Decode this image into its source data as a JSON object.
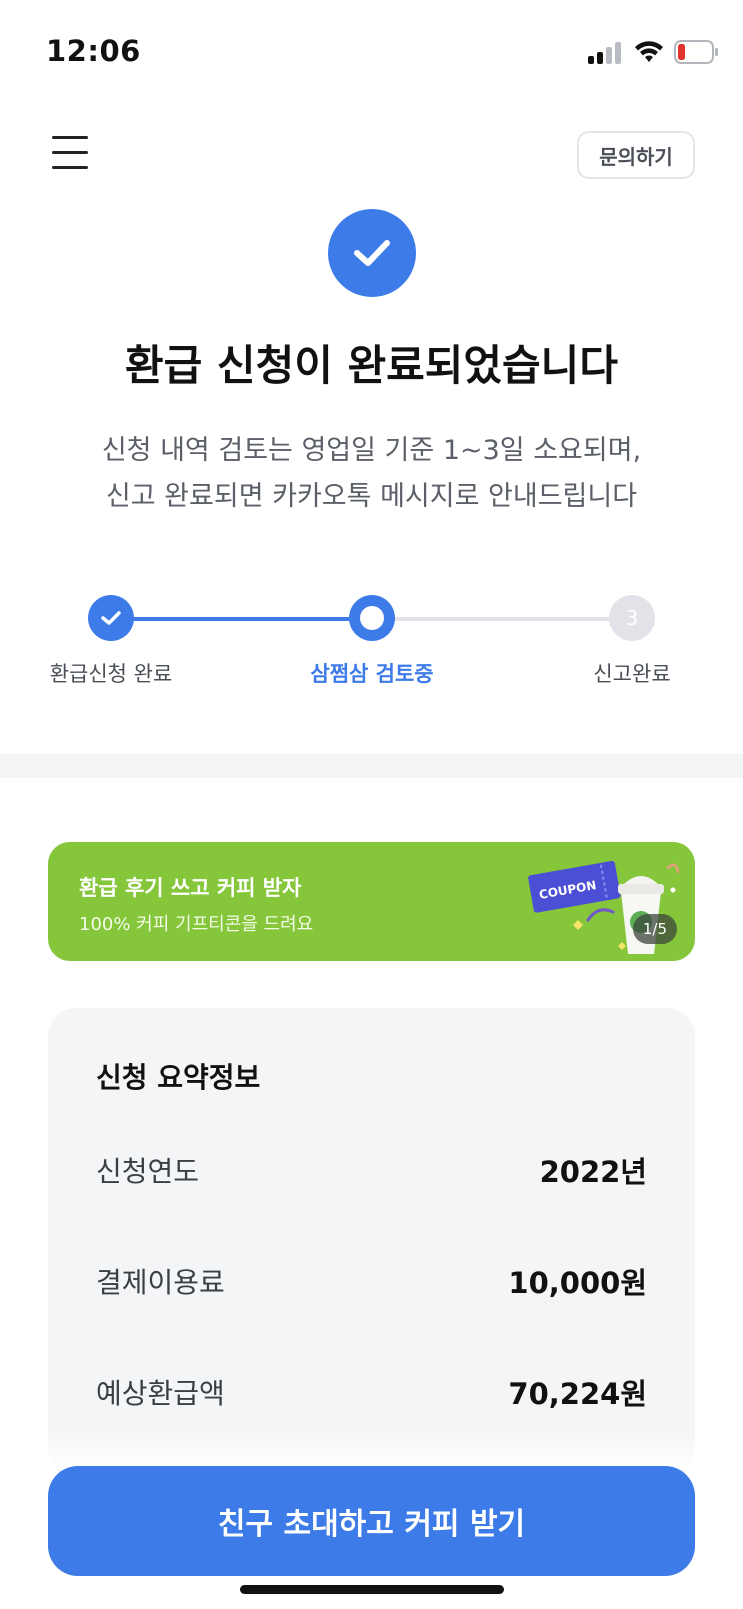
{
  "status_bar": {
    "time": "12:06"
  },
  "header": {
    "inquiry_label": "문의하기"
  },
  "hero": {
    "title": "환급 신청이 완료되었습니다",
    "desc_line1": "신청 내역 검토는 영업일 기준 1~3일 소요되며,",
    "desc_line2": "신고 완료되면 카카오톡 메시지로 안내드립니다"
  },
  "stepper": {
    "steps": [
      {
        "label": "환급신청 완료",
        "state": "done"
      },
      {
        "label": "삼쩜삼 검토중",
        "state": "current"
      },
      {
        "label": "신고완료",
        "state": "pending",
        "number": "3"
      }
    ]
  },
  "banner": {
    "title": "환급 후기 쓰고 커피 받자",
    "subtitle": "100% 커피 기프티콘을 드려요",
    "coupon_text": "COUPON",
    "counter": "1/5"
  },
  "summary": {
    "title": "신청 요약정보",
    "rows": [
      {
        "label": "신청연도",
        "value": "2022년"
      },
      {
        "label": "결제이용료",
        "value": "10,000원"
      },
      {
        "label": "예상환급액",
        "value": "70,224원"
      }
    ]
  },
  "cta": {
    "label": "친구 초대하고 커피 받기"
  },
  "colors": {
    "primary": "#3d7be8",
    "banner_green": "#86c63a",
    "inactive": "#e1e3e8",
    "battery_low": "#e0342c"
  }
}
